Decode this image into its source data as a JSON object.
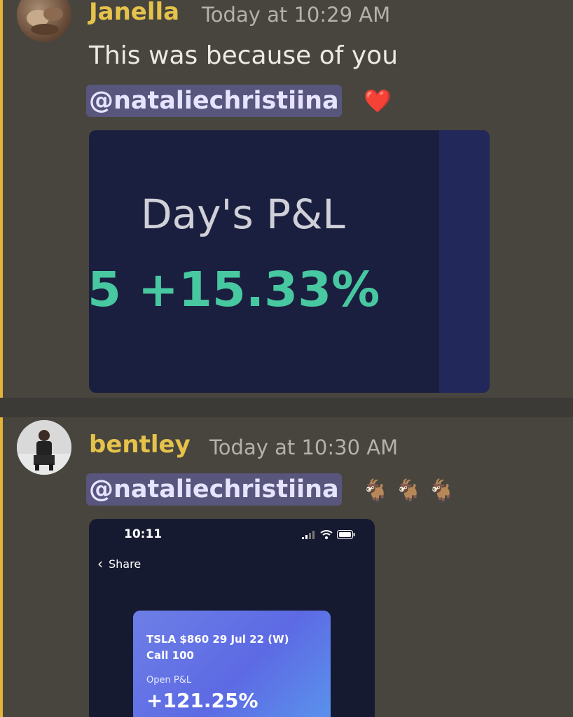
{
  "message1": {
    "username": "Janella",
    "username_color": "#e5c24a",
    "timestamp": "Today at 10:29 AM",
    "text": "This was because of you",
    "mention": "@nataliechristiina",
    "emoji": "❤️",
    "embed": {
      "title": "Day's P&L",
      "value_prefix": "5",
      "value": "+15.33%"
    }
  },
  "message2": {
    "username": "bentley",
    "username_color": "#e5c24a",
    "timestamp": "Today at 10:30 AM",
    "mention": "@nataliechristiina",
    "emojis": [
      "🐐",
      "🐐",
      "🐐"
    ],
    "embed": {
      "status_time": "10:11",
      "back_label": "Share",
      "card": {
        "ticker_line1": "TSLA $860 29 Jul 22 (W)",
        "ticker_line2": "Call 100",
        "open_pl_label": "Open P&L",
        "open_pl_value": "+121.25%"
      }
    }
  },
  "icons": [
    "signal-icon",
    "wifi-icon",
    "battery-icon",
    "chevron-left-icon"
  ]
}
